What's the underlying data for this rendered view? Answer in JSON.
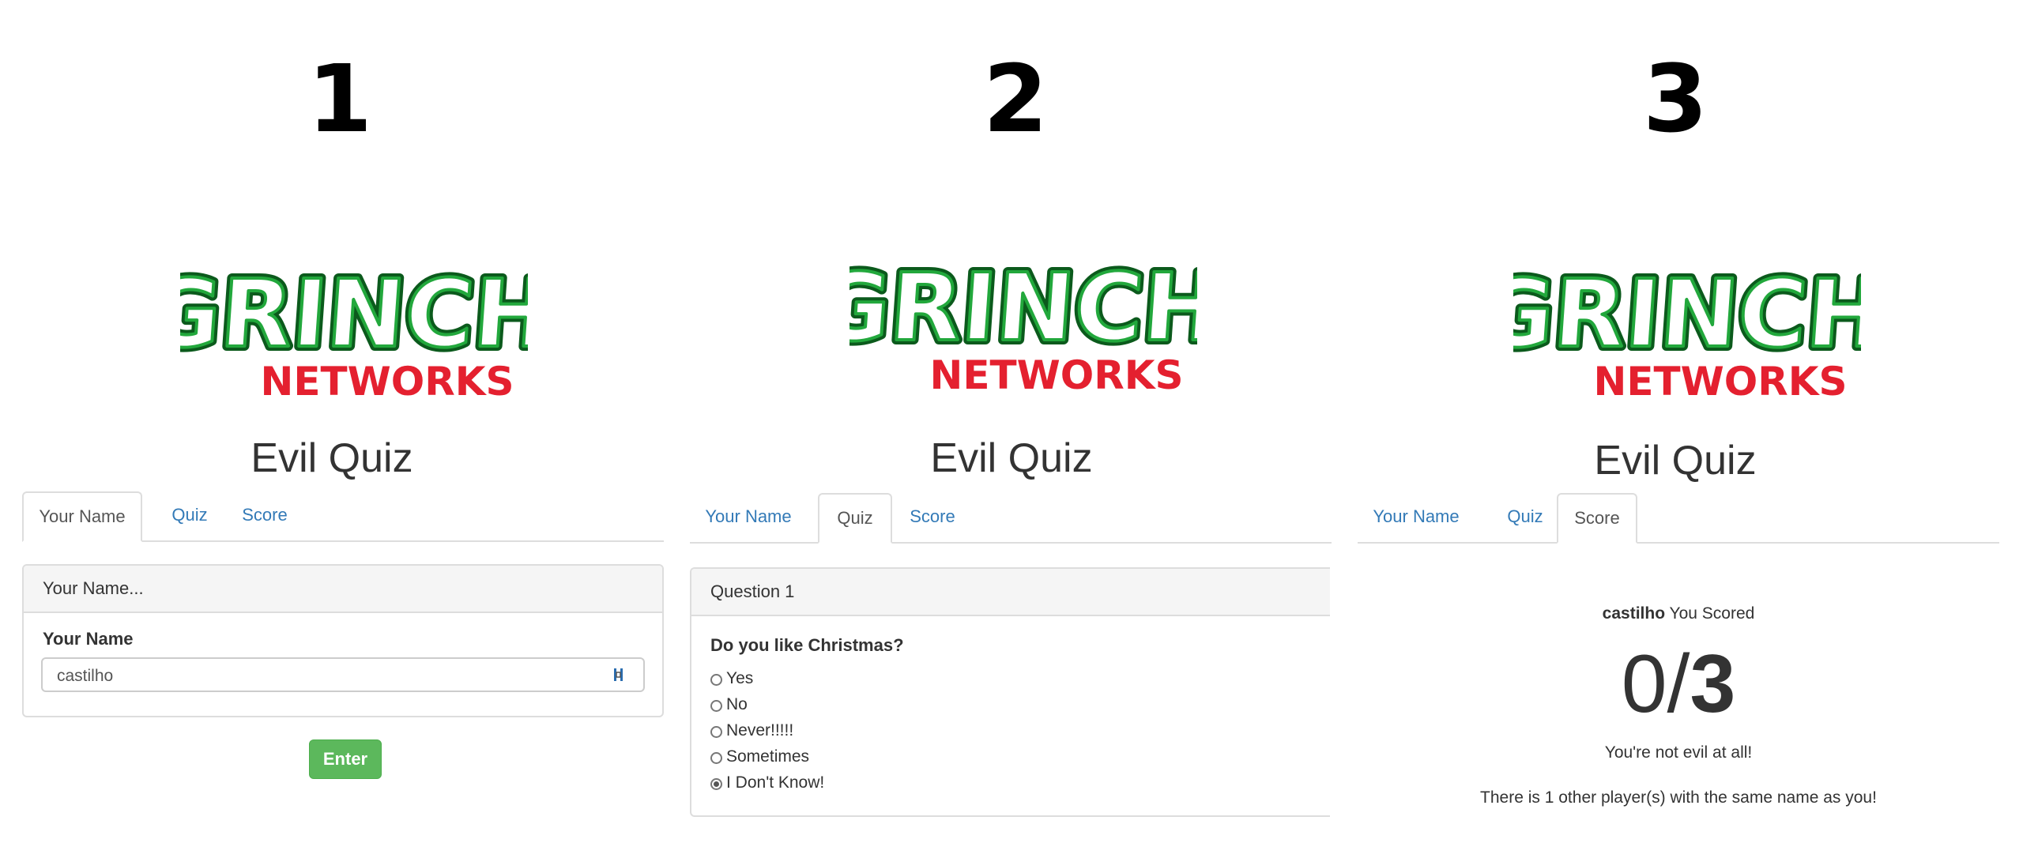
{
  "panels": [
    {
      "step": "1",
      "logo": {
        "text_top": "GRINCH",
        "text_bottom": "NETWORKS",
        "icon": "grinch-networks-logo"
      },
      "title": "Evil Quiz",
      "tabs": [
        "Your Name",
        "Quiz",
        "Score"
      ],
      "active_tab": "Your Name",
      "card_header": "Your Name...",
      "field_label": "Your Name",
      "field_value": "castilho",
      "button_label": "Enter"
    },
    {
      "step": "2",
      "logo": {
        "text_top": "GRINCH",
        "text_bottom": "NETWORKS",
        "icon": "grinch-networks-logo"
      },
      "title": "Evil Quiz",
      "tabs": [
        "Your Name",
        "Quiz",
        "Score"
      ],
      "active_tab": "Quiz",
      "card_header": "Question 1",
      "question": "Do you like Christmas?",
      "options": [
        "Yes",
        "No",
        "Never!!!!!",
        "Sometimes",
        "I Don't Know!"
      ],
      "selected_option": "I Don't Know!"
    },
    {
      "step": "3",
      "logo": {
        "text_top": "GRINCH",
        "text_bottom": "NETWORKS",
        "icon": "grinch-networks-logo"
      },
      "title": "Evil Quiz",
      "tabs": [
        "Your Name",
        "Quiz",
        "Score"
      ],
      "active_tab": "Score",
      "player_name": "castilho",
      "scored_label": "You Scored",
      "score_value": "0",
      "score_separator": "/",
      "score_total": "3",
      "verdict": "You're not evil at all!",
      "same_name_note": "There is 1 other player(s) with the same name as you!"
    }
  ],
  "colors": {
    "link": "#337ab7",
    "button_green": "#5cb85c",
    "logo_green": "#1a8a2e",
    "logo_red": "#e4202f"
  }
}
